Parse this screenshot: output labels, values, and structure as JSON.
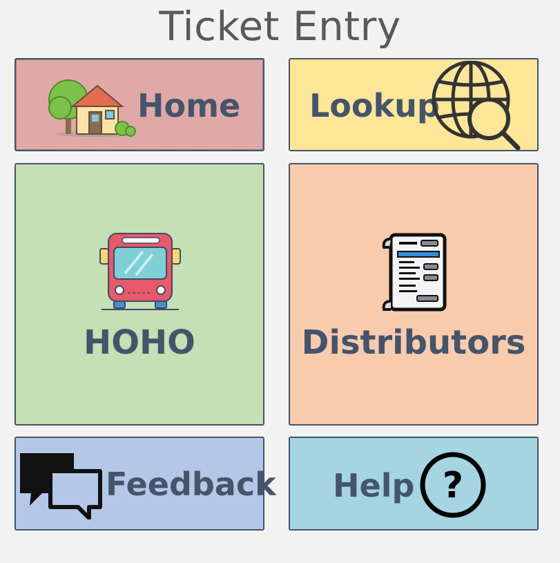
{
  "title": "Ticket Entry",
  "tiles": {
    "home": {
      "label": "Home",
      "icon": "house-icon",
      "color": "#e0a9a7"
    },
    "lookup": {
      "label": "Lookup",
      "icon": "globe-search-icon",
      "color": "#fee699"
    },
    "hoho": {
      "label": "HOHO",
      "icon": "bus-icon",
      "color": "#c5e0b4"
    },
    "distributors": {
      "label": "Distributors",
      "icon": "receipt-icon",
      "color": "#f8cbad"
    },
    "feedback": {
      "label": "Feedback",
      "icon": "speech-bubbles-icon",
      "color": "#b4c7e7"
    },
    "help": {
      "label": "Help",
      "icon": "question-mark-icon",
      "color": "#a6d5e2"
    }
  }
}
